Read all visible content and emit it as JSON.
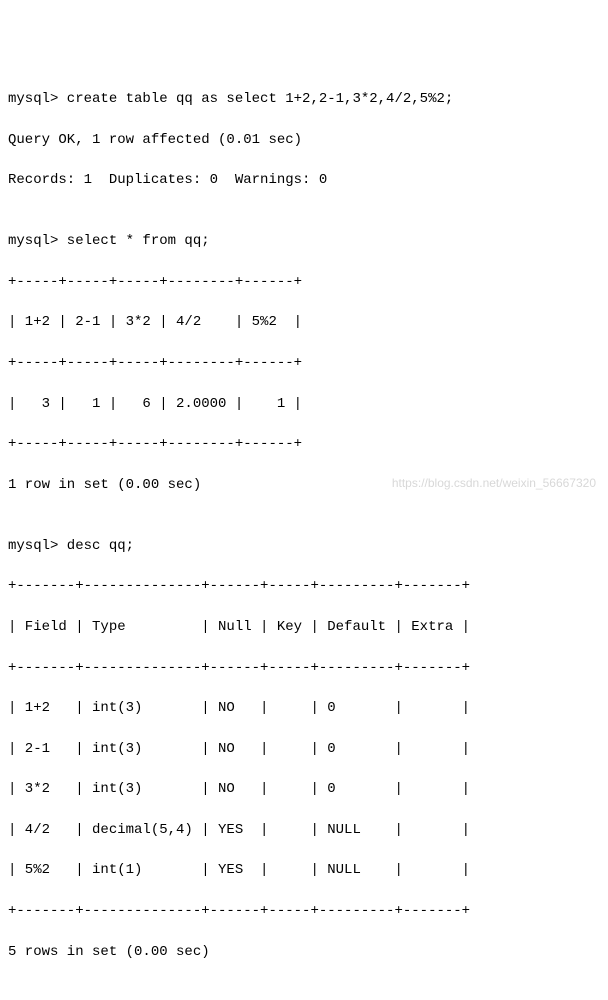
{
  "lines": {
    "cmd1": "mysql> create table qq as select 1+2,2-1,3*2,4/2,5%2;",
    "res1a": "Query OK, 1 row affected (0.01 sec)",
    "res1b": "Records: 1  Duplicates: 0  Warnings: 0",
    "blank1": "",
    "cmd2": "mysql> select * from qq;",
    "sep2a": "+-----+-----+-----+--------+------+",
    "hdr2": "| 1+2 | 2-1 | 3*2 | 4/2    | 5%2  |",
    "sep2b": "+-----+-----+-----+--------+------+",
    "row2": "|   3 |   1 |   6 | 2.0000 |    1 |",
    "sep2c": "+-----+-----+-----+--------+------+",
    "res2": "1 row in set (0.00 sec)",
    "blank2": "",
    "cmd3": "mysql> desc qq;",
    "sep3a": "+-------+--------------+------+-----+---------+-------+",
    "hdr3": "| Field | Type         | Null | Key | Default | Extra |",
    "sep3b": "+-------+--------------+------+-----+---------+-------+",
    "r3a": "| 1+2   | int(3)       | NO   |     | 0       |       |",
    "r3b": "| 2-1   | int(3)       | NO   |     | 0       |       |",
    "r3c": "| 3*2   | int(3)       | NO   |     | 0       |       |",
    "r3d": "| 4/2   | decimal(5,4) | YES  |     | NULL    |       |",
    "r3e": "| 5%2   | int(1)       | YES  |     | NULL    |       |",
    "sep3c": "+-------+--------------+------+-----+---------+-------+",
    "res3": "5 rows in set (0.00 sec)"
  },
  "watermark": "https://blog.csdn.net/weixin_56667320"
}
